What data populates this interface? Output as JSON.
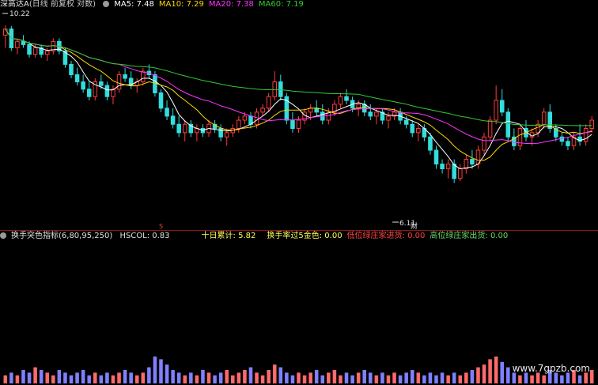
{
  "price_panel": {
    "symbol": "深高达A",
    "period": "(日线 前复权 对数)",
    "ma_labels": [
      {
        "text": "MA5: 7.48",
        "color": "#ffffff"
      },
      {
        "text": "MA10: 7.29",
        "color": "#ffd700"
      },
      {
        "text": "MA20: 7.38",
        "color": "#ff33ff"
      },
      {
        "text": "MA60: 7.19",
        "color": "#33cc33"
      }
    ],
    "high_label": "10.22",
    "low_label": "6.11",
    "event_tag": "财",
    "marker_s": "S"
  },
  "indicator_panel": {
    "name": "换手突色指标(6,80,95,250)",
    "fields": [
      {
        "text": "HSCOL: 0.83",
        "color": "#e0e0e0"
      },
      {
        "text": "十日累计: 5.82",
        "color": "#ffff55"
      },
      {
        "text": "换手率过5金色: 0.00",
        "color": "#ffff55"
      },
      {
        "text": "低位绿庄家进货: 0.00",
        "color": "#ff4444"
      },
      {
        "text": "高位绿庄家出货: 0.00",
        "color": "#66dd66"
      }
    ]
  },
  "watermark": "www.7gpzb.com",
  "colors": {
    "up": "#ff3c3c",
    "down": "#33dddd",
    "ma5": "#ffffff",
    "ma10": "#ffd700",
    "ma20": "#ff33ff",
    "ma60": "#33cc33"
  },
  "chart_data": {
    "type": "candlestick",
    "note_y": "log scale",
    "ylim": [
      5.9,
      10.6
    ],
    "candles": [
      [
        9.9,
        10.22,
        9.5,
        10.1
      ],
      [
        10.1,
        10.2,
        9.4,
        9.5
      ],
      [
        9.5,
        9.8,
        9.3,
        9.7
      ],
      [
        9.7,
        9.9,
        9.5,
        9.6
      ],
      [
        9.6,
        9.7,
        9.2,
        9.3
      ],
      [
        9.3,
        9.6,
        9.2,
        9.5
      ],
      [
        9.5,
        9.6,
        9.2,
        9.3
      ],
      [
        9.3,
        9.5,
        9.1,
        9.4
      ],
      [
        9.4,
        9.8,
        9.3,
        9.7
      ],
      [
        9.7,
        9.8,
        9.3,
        9.4
      ],
      [
        9.4,
        9.5,
        8.9,
        9.0
      ],
      [
        9.0,
        9.1,
        8.6,
        8.7
      ],
      [
        8.7,
        8.9,
        8.4,
        8.5
      ],
      [
        8.5,
        8.7,
        8.2,
        8.3
      ],
      [
        8.3,
        8.5,
        8.0,
        8.1
      ],
      [
        8.1,
        8.6,
        8.0,
        8.5
      ],
      [
        8.5,
        8.7,
        8.3,
        8.4
      ],
      [
        8.4,
        8.5,
        8.0,
        8.1
      ],
      [
        8.1,
        8.4,
        7.9,
        8.3
      ],
      [
        8.3,
        8.8,
        8.2,
        8.7
      ],
      [
        8.7,
        8.9,
        8.5,
        8.6
      ],
      [
        8.6,
        8.8,
        8.3,
        8.4
      ],
      [
        8.4,
        8.6,
        8.2,
        8.5
      ],
      [
        8.5,
        8.9,
        8.4,
        8.8
      ],
      [
        8.8,
        9.0,
        8.6,
        8.7
      ],
      [
        8.7,
        8.8,
        8.1,
        8.2
      ],
      [
        8.2,
        8.3,
        7.7,
        7.8
      ],
      [
        7.8,
        8.0,
        7.5,
        7.6
      ],
      [
        7.6,
        7.8,
        7.3,
        7.4
      ],
      [
        7.4,
        7.6,
        7.1,
        7.2
      ],
      [
        7.2,
        7.5,
        7.0,
        7.4
      ],
      [
        7.4,
        7.5,
        7.1,
        7.2
      ],
      [
        7.2,
        7.4,
        7.0,
        7.3
      ],
      [
        7.3,
        7.4,
        7.1,
        7.2
      ],
      [
        7.2,
        7.5,
        7.1,
        7.4
      ],
      [
        7.4,
        7.5,
        7.2,
        7.3
      ],
      [
        7.3,
        7.4,
        7.0,
        7.1
      ],
      [
        7.1,
        7.3,
        6.9,
        7.2
      ],
      [
        7.2,
        7.4,
        7.1,
        7.3
      ],
      [
        7.3,
        7.6,
        7.2,
        7.5
      ],
      [
        7.5,
        7.7,
        7.4,
        7.6
      ],
      [
        7.6,
        7.7,
        7.3,
        7.4
      ],
      [
        7.4,
        7.8,
        7.3,
        7.7
      ],
      [
        7.7,
        7.9,
        7.6,
        7.8
      ],
      [
        7.8,
        8.2,
        7.7,
        8.1
      ],
      [
        8.1,
        8.8,
        8.0,
        8.5
      ],
      [
        8.5,
        8.7,
        8.0,
        8.1
      ],
      [
        8.1,
        8.2,
        7.4,
        7.5
      ],
      [
        7.5,
        7.7,
        7.2,
        7.3
      ],
      [
        7.3,
        7.6,
        7.2,
        7.5
      ],
      [
        7.5,
        7.8,
        7.4,
        7.7
      ],
      [
        7.7,
        7.9,
        7.5,
        7.8
      ],
      [
        7.8,
        8.0,
        7.6,
        7.7
      ],
      [
        7.7,
        7.9,
        7.4,
        7.5
      ],
      [
        7.5,
        7.8,
        7.4,
        7.7
      ],
      [
        7.7,
        8.0,
        7.6,
        7.9
      ],
      [
        7.9,
        8.2,
        7.8,
        8.1
      ],
      [
        8.1,
        8.3,
        7.9,
        8.0
      ],
      [
        8.0,
        8.1,
        7.7,
        7.8
      ],
      [
        7.8,
        8.0,
        7.6,
        7.9
      ],
      [
        7.9,
        8.0,
        7.6,
        7.7
      ],
      [
        7.7,
        7.9,
        7.5,
        7.6
      ],
      [
        7.6,
        7.8,
        7.4,
        7.7
      ],
      [
        7.7,
        7.8,
        7.4,
        7.5
      ],
      [
        7.5,
        7.7,
        7.3,
        7.6
      ],
      [
        7.6,
        7.8,
        7.5,
        7.7
      ],
      [
        7.7,
        7.8,
        7.4,
        7.5
      ],
      [
        7.5,
        7.6,
        7.3,
        7.4
      ],
      [
        7.4,
        7.5,
        7.1,
        7.2
      ],
      [
        7.2,
        7.4,
        7.0,
        7.3
      ],
      [
        7.3,
        7.4,
        7.0,
        7.1
      ],
      [
        7.1,
        7.2,
        6.7,
        6.8
      ],
      [
        6.8,
        6.9,
        6.4,
        6.5
      ],
      [
        6.5,
        6.6,
        6.3,
        6.4
      ],
      [
        6.4,
        6.6,
        6.2,
        6.5
      ],
      [
        6.5,
        6.6,
        6.11,
        6.2
      ],
      [
        6.2,
        6.5,
        6.15,
        6.4
      ],
      [
        6.4,
        6.7,
        6.3,
        6.6
      ],
      [
        6.6,
        6.8,
        6.4,
        6.5
      ],
      [
        6.5,
        6.9,
        6.4,
        6.8
      ],
      [
        6.8,
        7.2,
        6.7,
        7.1
      ],
      [
        7.1,
        7.6,
        7.0,
        7.5
      ],
      [
        7.5,
        8.4,
        7.4,
        8.0
      ],
      [
        8.0,
        8.3,
        7.6,
        7.7
      ],
      [
        7.7,
        7.8,
        7.0,
        7.1
      ],
      [
        7.1,
        7.3,
        6.8,
        6.9
      ],
      [
        6.9,
        7.4,
        6.8,
        7.3
      ],
      [
        7.3,
        7.5,
        7.0,
        7.1
      ],
      [
        7.1,
        7.3,
        6.9,
        7.2
      ],
      [
        7.2,
        7.5,
        7.1,
        7.4
      ],
      [
        7.4,
        7.8,
        7.3,
        7.7
      ],
      [
        7.7,
        7.9,
        7.2,
        7.3
      ],
      [
        7.3,
        7.4,
        7.0,
        7.1
      ],
      [
        7.1,
        7.2,
        6.9,
        7.0
      ],
      [
        7.0,
        7.1,
        6.8,
        6.9
      ],
      [
        6.9,
        7.2,
        6.8,
        7.1
      ],
      [
        7.1,
        7.4,
        6.9,
        7.0
      ],
      [
        7.0,
        7.4,
        6.9,
        7.3
      ],
      [
        7.3,
        7.6,
        7.2,
        7.5
      ]
    ],
    "volume": [
      0.3,
      0.4,
      0.3,
      0.5,
      0.4,
      0.6,
      0.5,
      0.4,
      0.3,
      0.5,
      0.4,
      0.3,
      0.4,
      0.5,
      0.3,
      0.4,
      0.3,
      0.4,
      0.3,
      0.4,
      0.5,
      0.4,
      0.3,
      0.4,
      0.6,
      1.0,
      0.9,
      0.7,
      0.5,
      0.4,
      0.3,
      0.4,
      0.3,
      0.5,
      0.4,
      0.3,
      0.4,
      0.5,
      0.3,
      0.4,
      0.5,
      0.6,
      0.4,
      0.3,
      0.5,
      0.7,
      0.6,
      0.4,
      0.3,
      0.4,
      0.3,
      0.4,
      0.5,
      0.3,
      0.4,
      0.5,
      0.3,
      0.4,
      0.3,
      0.4,
      0.5,
      0.4,
      0.3,
      0.4,
      0.3,
      0.4,
      0.3,
      0.4,
      0.5,
      0.4,
      0.3,
      0.4,
      0.3,
      0.4,
      0.3,
      0.4,
      0.3,
      0.4,
      0.5,
      0.6,
      0.7,
      0.9,
      1.0,
      0.8,
      0.6,
      0.4,
      0.3,
      0.4,
      0.3,
      0.4,
      0.3,
      0.5,
      0.4,
      0.3,
      0.4,
      0.5,
      0.3,
      0.4,
      0.5
    ]
  }
}
